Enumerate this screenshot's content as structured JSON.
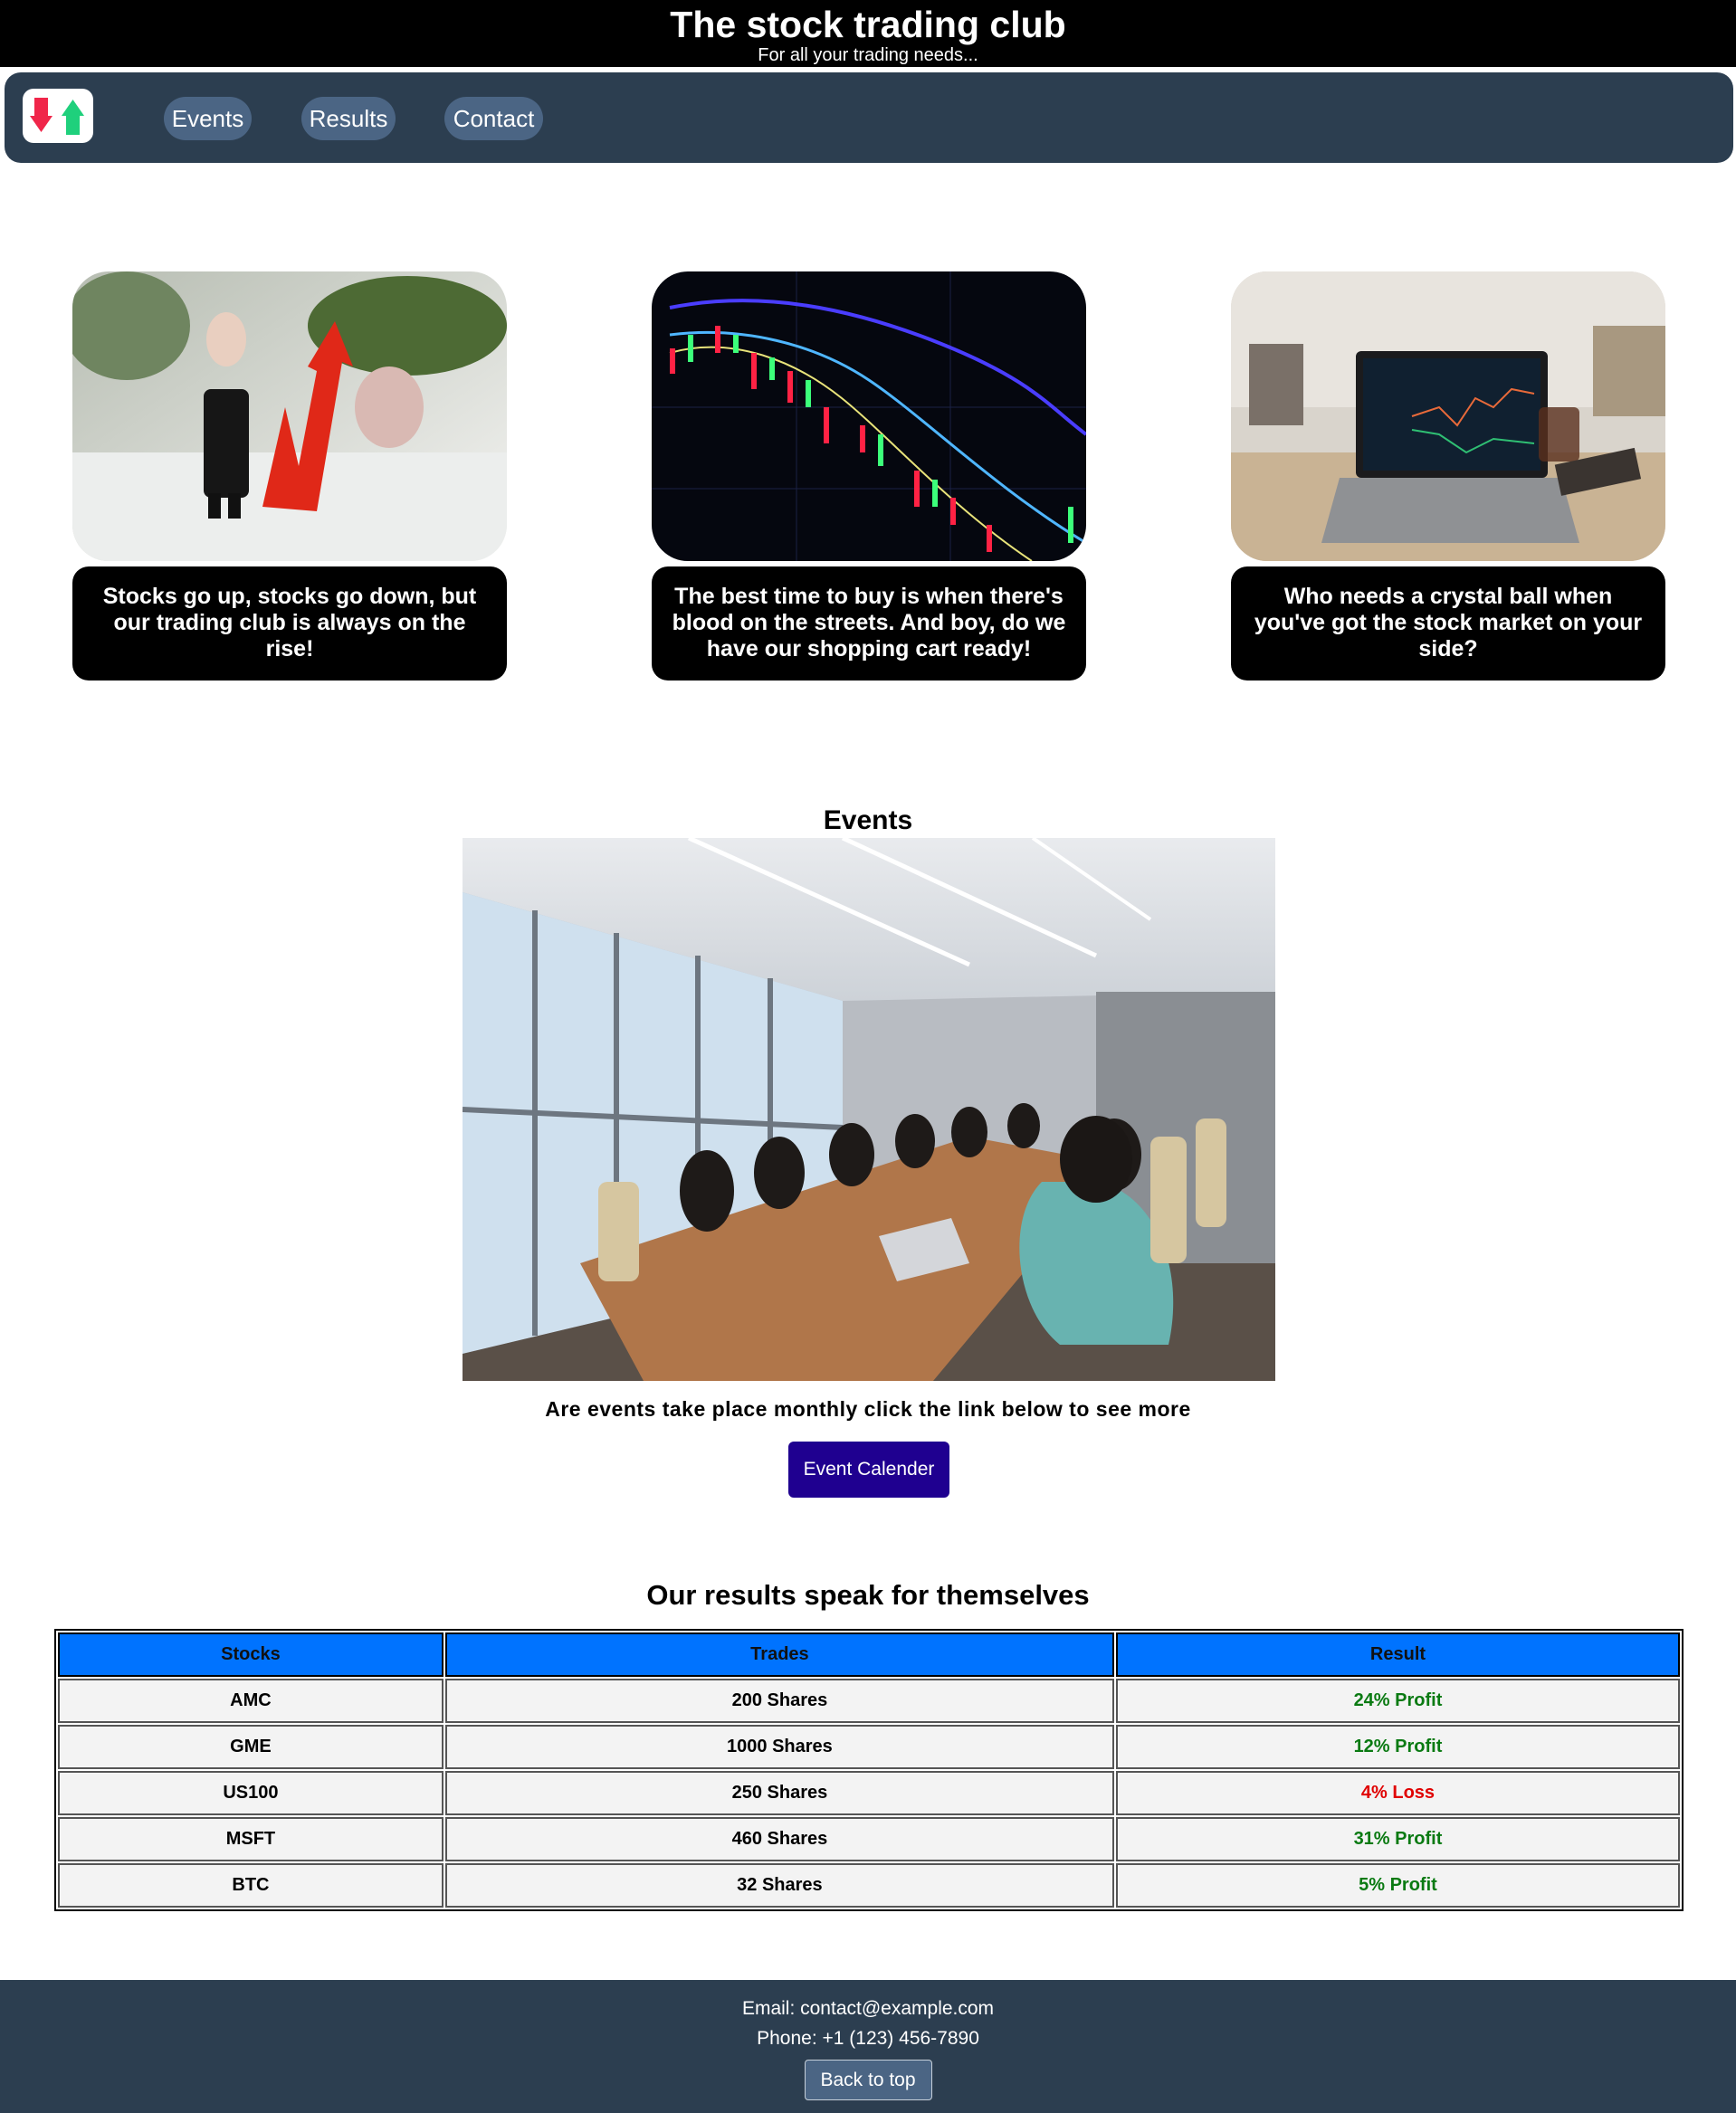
{
  "header": {
    "title": "The stock trading club",
    "tagline": "For all your trading needs..."
  },
  "nav": {
    "logo": "stock-up-down-arrows-icon",
    "links": [
      {
        "label": "Events"
      },
      {
        "label": "Results"
      },
      {
        "label": "Contact"
      }
    ]
  },
  "features": [
    {
      "image": "figurine-with-rising-arrow-photo",
      "caption": "Stocks go up, stocks go down, but our trading club is always on the rise!"
    },
    {
      "image": "candlestick-chart-photo",
      "caption": "The best time to buy is when there's blood on the streets. And boy, do we have our shopping cart ready!"
    },
    {
      "image": "laptop-with-trading-chart-photo",
      "caption": "Who needs a crystal ball when you've got the stock market on your side?"
    }
  ],
  "events": {
    "heading": "Events",
    "image": "meeting-room-photo",
    "text": "Are events take place monthly click the link below to see more",
    "button_label": "Event Calender"
  },
  "results": {
    "heading": "Our results speak for themselves",
    "columns": [
      "Stocks",
      "Trades",
      "Result"
    ],
    "rows": [
      {
        "stock": "AMC",
        "trades": "200 Shares",
        "result": "24% Profit",
        "type": "profit"
      },
      {
        "stock": "GME",
        "trades": "1000 Shares",
        "result": "12% Profit",
        "type": "profit"
      },
      {
        "stock": "US100",
        "trades": "250 Shares",
        "result": "4% Loss",
        "type": "loss"
      },
      {
        "stock": "MSFT",
        "trades": "460 Shares",
        "result": "31% Profit",
        "type": "profit"
      },
      {
        "stock": "BTC",
        "trades": "32 Shares",
        "result": "5% Profit",
        "type": "profit"
      }
    ]
  },
  "footer": {
    "email": "Email: contact@example.com",
    "phone": "Phone: +1 (123) 456-7890",
    "back_to_top": "Back to top"
  },
  "colors": {
    "header_bg": "#000000",
    "nav_bg": "#2c3e50",
    "nav_link_bg": "#4b6584",
    "event_button_bg": "#1f0090",
    "table_header_bg": "#0073ff",
    "profit": "#0a7a12",
    "loss": "#e00000"
  }
}
